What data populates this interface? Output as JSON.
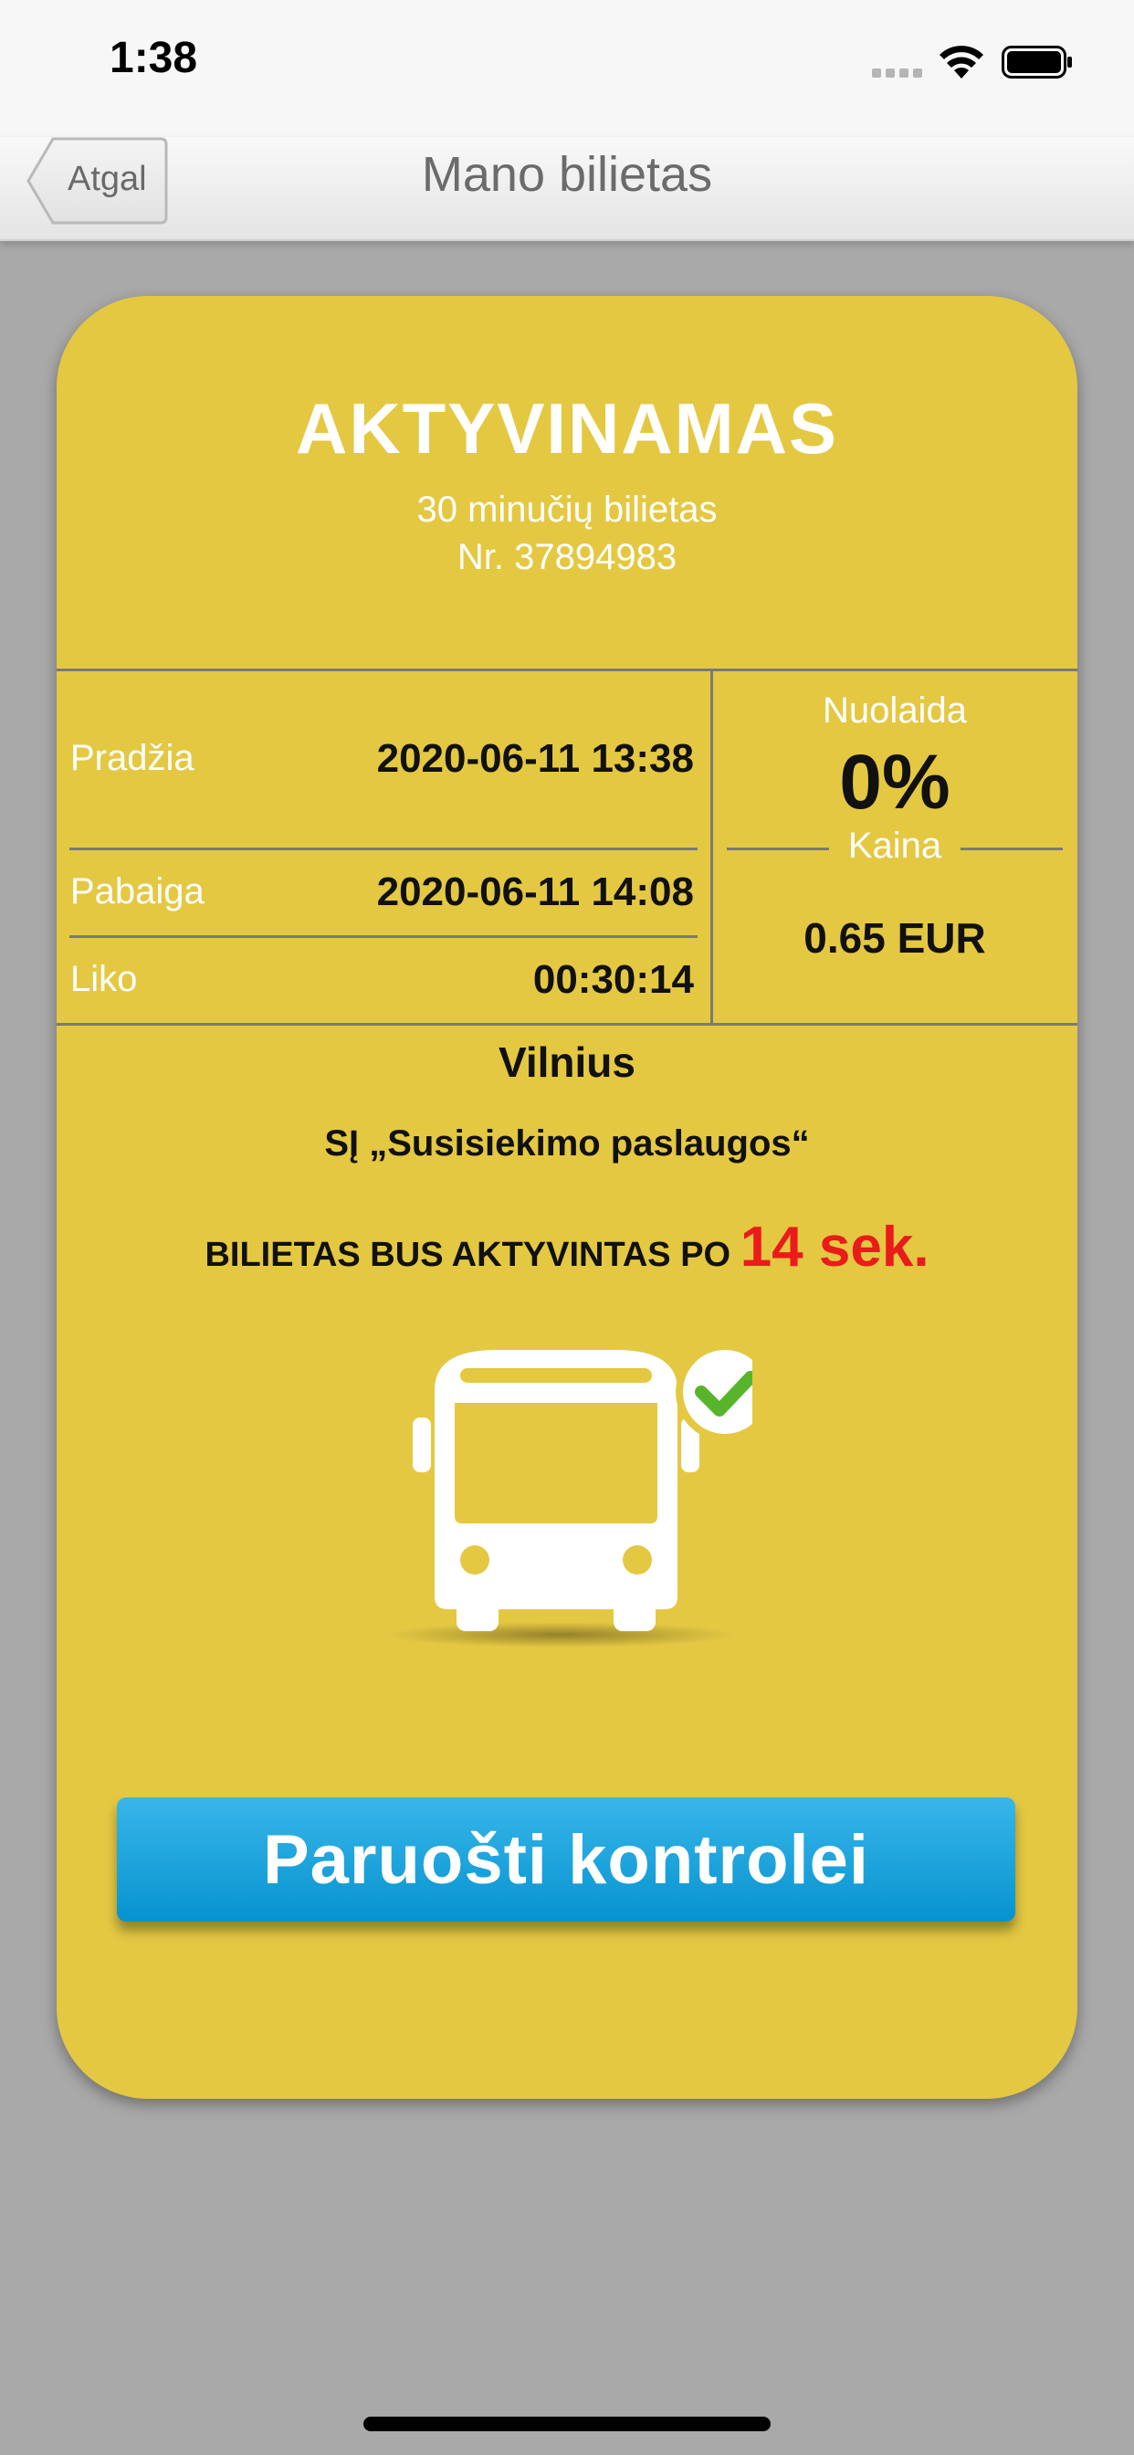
{
  "status_bar": {
    "time": "1:38"
  },
  "nav": {
    "back_label": "Atgal",
    "title": "Mano bilietas"
  },
  "ticket": {
    "status": "AKTYVINAMAS",
    "type": "30 minučių bilietas",
    "number": "Nr. 37894983",
    "rows": [
      {
        "label": "Pradžia",
        "value": "2020-06-11 13:38"
      },
      {
        "label": "Pabaiga",
        "value": "2020-06-11 14:08"
      },
      {
        "label": "Liko",
        "value": "00:30:14"
      }
    ],
    "discount_label": "Nuolaida",
    "discount_value": "0%",
    "price_label": "Kaina",
    "price_value": "0.65 EUR",
    "city": "Vilnius",
    "operator": "SĮ „Susisiekimo paslaugos“",
    "activation_text": "BILIETAS BUS AKTYVINTAS PO",
    "countdown": "14 sek.",
    "control_button": "Paruošti kontrolei"
  },
  "colors": {
    "ticket_bg": "#e4c842",
    "button_blue": "#1aa6e0",
    "countdown_red": "#ea1b1b",
    "check_green": "#58b52b"
  },
  "icons": [
    "signal-icon",
    "wifi-icon",
    "battery-icon",
    "back-chevron-icon",
    "bus-icon",
    "checkmark-icon"
  ]
}
